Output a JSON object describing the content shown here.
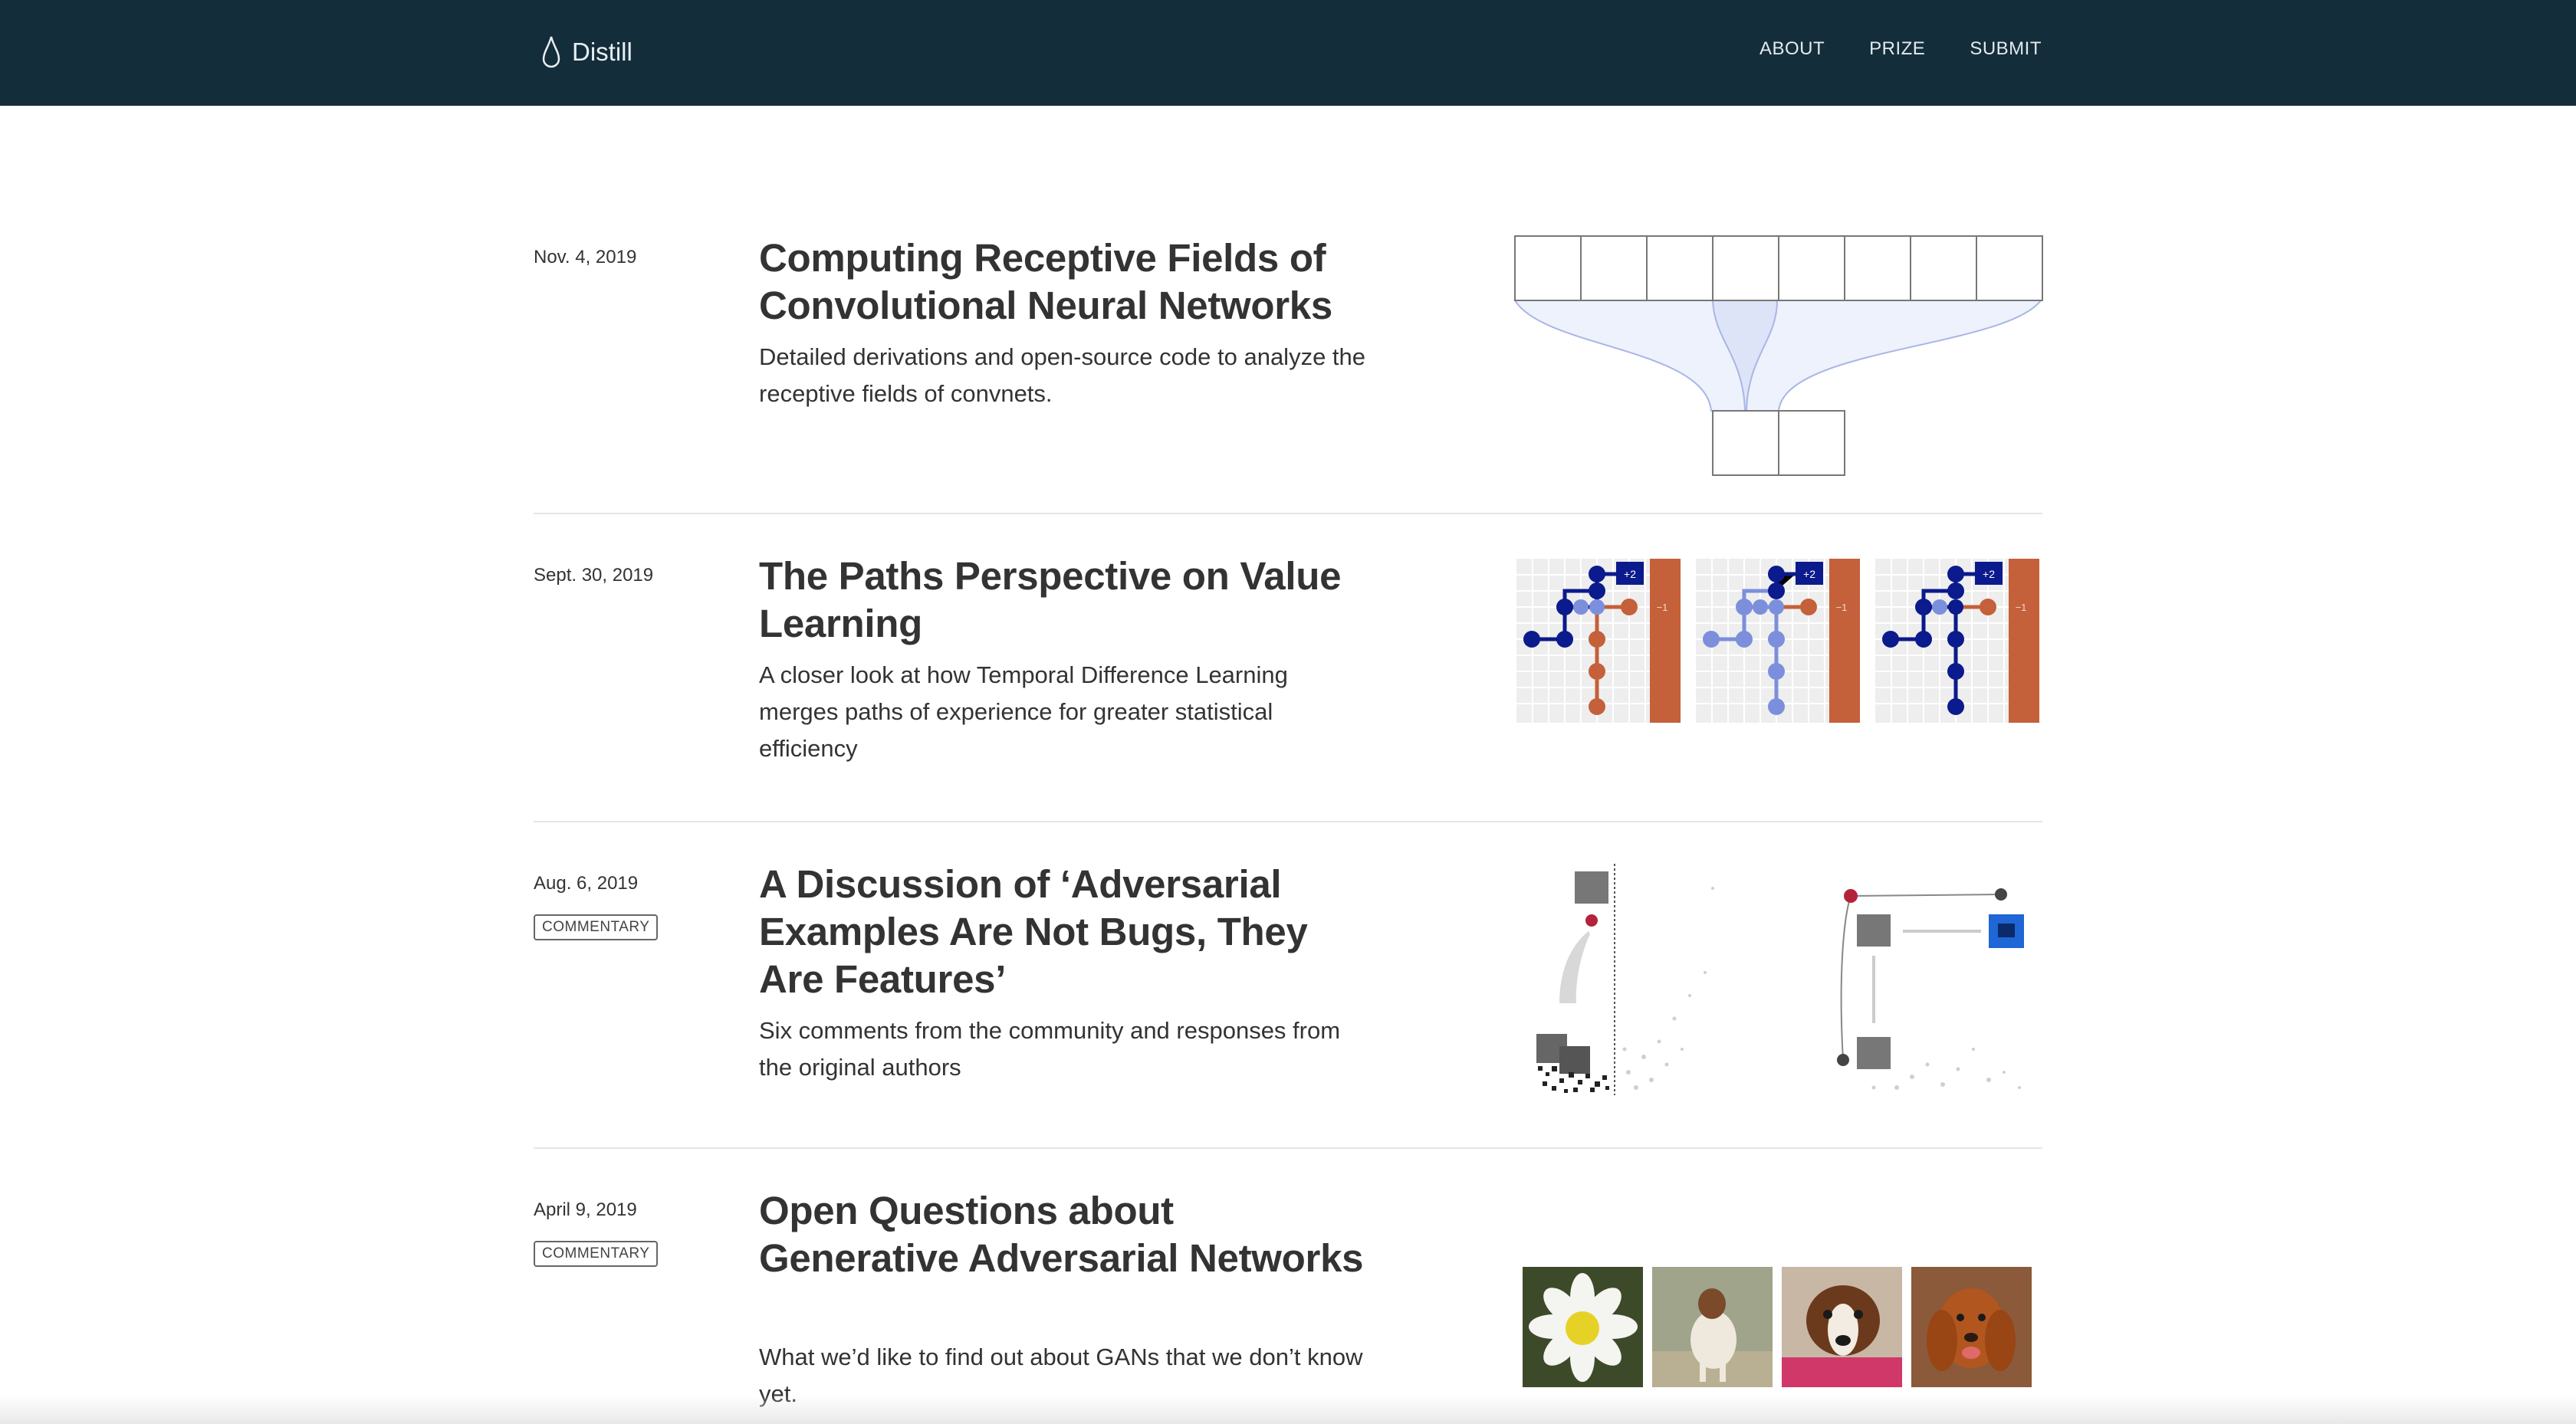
{
  "header": {
    "brand": "Distill",
    "nav": {
      "about": "ABOUT",
      "prize": "PRIZE",
      "submit": "SUBMIT"
    }
  },
  "posts": [
    {
      "date": "Nov. 4, 2019",
      "badge": "",
      "title": "Computing Receptive Fields of Convolutional Neural Networks",
      "description": "Detailed derivations and open-source code to analyze the receptive fields of convnets."
    },
    {
      "date": "Sept. 30, 2019",
      "badge": "",
      "title": "The Paths Perspective on Value Learning",
      "description": "A closer look at how Temporal Difference Learning merges paths of experience for greater statistical efficiency",
      "figure_labels": {
        "reward": "+2",
        "penalty": "−1"
      }
    },
    {
      "date": "Aug. 6, 2019",
      "badge": "COMMENTARY",
      "title": "A Discussion of ‘Adversarial Examples Are Not Bugs, They Are Features’",
      "description": "Six comments from the community and responses from the original authors"
    },
    {
      "date": "April 9, 2019",
      "badge": "COMMENTARY",
      "title": "Open Questions about Generative Adversarial Networks",
      "description": "What we’d like to find out about GANs that we don’t know yet."
    }
  ],
  "colors": {
    "header_bg": "#142d3b",
    "navy": "#0b1a8c",
    "light_blue": "#7b8fdc",
    "orange": "#c4603a"
  }
}
